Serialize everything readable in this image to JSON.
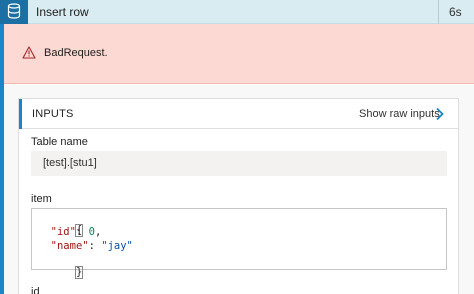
{
  "header": {
    "icon": "database-icon",
    "title": "Insert row",
    "duration": "6s",
    "color": "#1b6fa3"
  },
  "error": {
    "icon": "warning-icon",
    "message": "BadRequest."
  },
  "inputs": {
    "title": "INPUTS",
    "show_raw_label": "Show raw inputs",
    "chevron_icon": "chevron-right-icon",
    "table_name_label": "Table name",
    "table_name_value": "[test].[stu1]",
    "item_label": "item",
    "item_code": {
      "open": "{",
      "line1_key": "\"id\"",
      "line1_sep": ": ",
      "line1_val": "0",
      "line1_end": ",",
      "line2_key": "\"name\"",
      "line2_sep": ": ",
      "line2_val": "\"jay\"",
      "close": "}"
    },
    "next_label": "id"
  },
  "colors": {
    "accent": "#1a86c8",
    "error_bg": "#fcd9d3",
    "header_bg": "#d8ecf2"
  }
}
